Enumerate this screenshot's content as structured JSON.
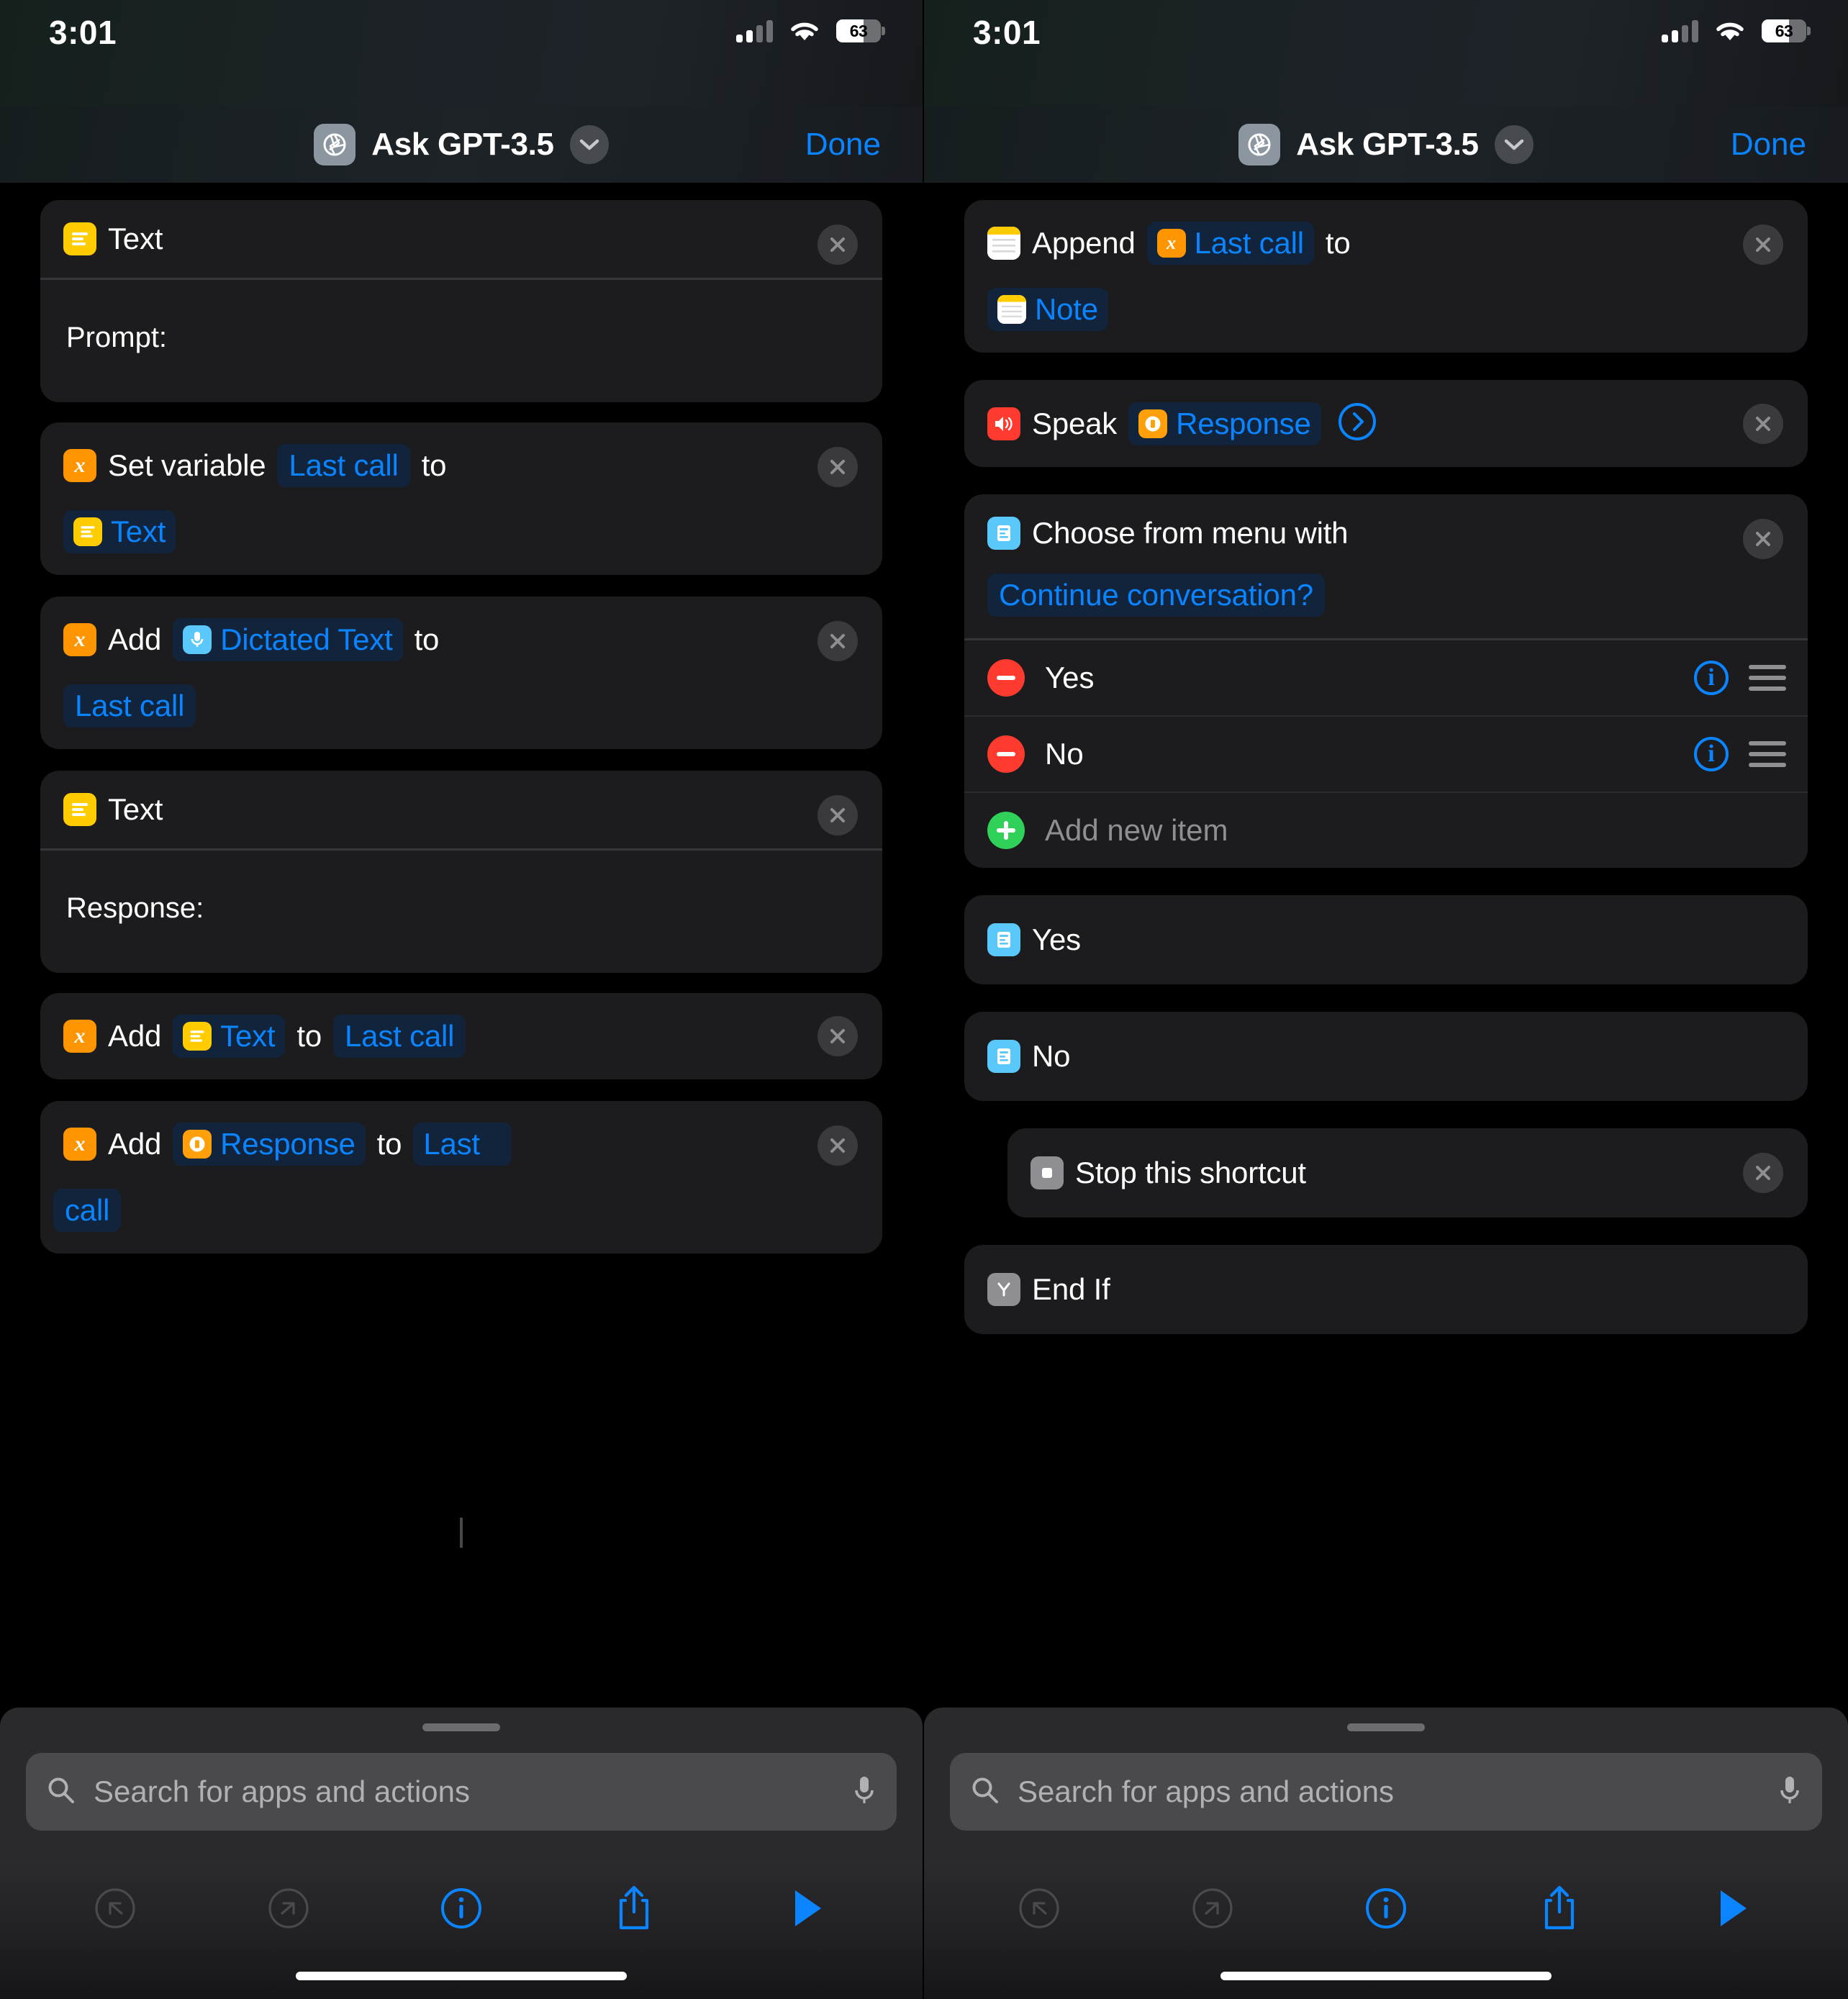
{
  "statusbar": {
    "time": "3:01",
    "battery_percent": "63",
    "cellular_icon": "cellular-signal-icon",
    "wifi_icon": "wifi-icon",
    "battery_icon": "battery-icon"
  },
  "navbar": {
    "title": "Ask GPT-3.5",
    "done_label": "Done",
    "app_icon": "shortcut-aperture-icon",
    "chevron_icon": "chevron-down-icon"
  },
  "colors": {
    "accent_blue": "#0a84ff",
    "card_bg": "#1c1c1e",
    "pill_bg": "#12243c",
    "var_orange": "#ff9500",
    "text_yellow": "#ffcc00",
    "mic_blue": "#5ac8fa",
    "speak_red": "#ff3b30",
    "menu_blue": "#5ac8fa",
    "delete_red": "#ff3b30",
    "add_green": "#30d158",
    "grey_icon": "#8e8e93"
  },
  "left_pane": {
    "cards": [
      {
        "id": "text-1",
        "title": "Text",
        "icon": "text-icon",
        "body_label": "Prompt:",
        "close_icon": "close-icon"
      },
      {
        "id": "set-variable",
        "icon": "variable-icon",
        "label": "Set variable",
        "var_pill": "Last call",
        "mid_label": "to",
        "value_pill": "Text",
        "value_pill_icon": "text-icon",
        "close_icon": "close-icon"
      },
      {
        "id": "add-dictated",
        "icon": "variable-icon",
        "label": "Add",
        "source_pill": "Dictated Text",
        "source_pill_icon": "microphone-icon",
        "mid_label": "to",
        "target_pill": "Last call",
        "close_icon": "close-icon"
      },
      {
        "id": "text-2",
        "title": "Text",
        "icon": "text-icon",
        "body_label": "Response:",
        "close_icon": "close-icon"
      },
      {
        "id": "add-text",
        "icon": "variable-icon",
        "label": "Add",
        "source_pill": "Text",
        "source_pill_icon": "text-icon",
        "mid_label": "to",
        "target_pill": "Last call",
        "close_icon": "close-icon"
      },
      {
        "id": "add-response",
        "icon": "variable-icon",
        "label": "Add",
        "source_pill": "Response",
        "source_pill_icon": "response-icon",
        "mid_label": "to",
        "target_pill_line1": "Last",
        "target_pill_line2": "call",
        "close_icon": "close-icon"
      }
    ]
  },
  "right_pane": {
    "cards": [
      {
        "id": "append-note",
        "icon": "notes-icon",
        "label": "Append",
        "var_pill": "Last call",
        "var_pill_icon": "variable-icon",
        "mid_label": "to",
        "target_pill": "Note",
        "target_pill_icon": "notes-icon",
        "close_icon": "close-icon"
      },
      {
        "id": "speak",
        "icon": "speaker-icon",
        "label": "Speak",
        "value_pill": "Response",
        "value_pill_icon": "response-icon",
        "expand_icon": "chevron-right-circle-icon",
        "close_icon": "close-icon"
      },
      {
        "id": "choose-from-menu",
        "icon": "menu-icon",
        "label": "Choose from menu with",
        "prompt_pill": "Continue conversation?",
        "close_icon": "close-icon",
        "items": [
          {
            "label": "Yes",
            "remove_icon": "minus-circle-icon",
            "info_icon": "info-circle-icon",
            "drag_icon": "drag-handle-icon"
          },
          {
            "label": "No",
            "remove_icon": "minus-circle-icon",
            "info_icon": "info-circle-icon",
            "drag_icon": "drag-handle-icon"
          }
        ],
        "add_item_label": "Add new item",
        "add_item_icon": "plus-circle-icon"
      },
      {
        "id": "menu-case-yes",
        "icon": "menu-icon",
        "label": "Yes"
      },
      {
        "id": "menu-case-no",
        "icon": "menu-icon",
        "label": "No"
      },
      {
        "id": "stop-shortcut",
        "icon": "stop-icon",
        "label": "Stop this shortcut",
        "close_icon": "close-icon"
      },
      {
        "id": "end-if",
        "icon": "end-if-icon",
        "label": "End If"
      }
    ]
  },
  "search": {
    "placeholder": "Search for apps and actions",
    "search_icon": "search-icon",
    "dictate_icon": "microphone-icon"
  },
  "toolbar": {
    "undo_icon": "undo-icon",
    "redo_icon": "redo-icon",
    "info_icon": "info-circle-icon",
    "share_icon": "share-icon",
    "play_icon": "play-icon"
  }
}
